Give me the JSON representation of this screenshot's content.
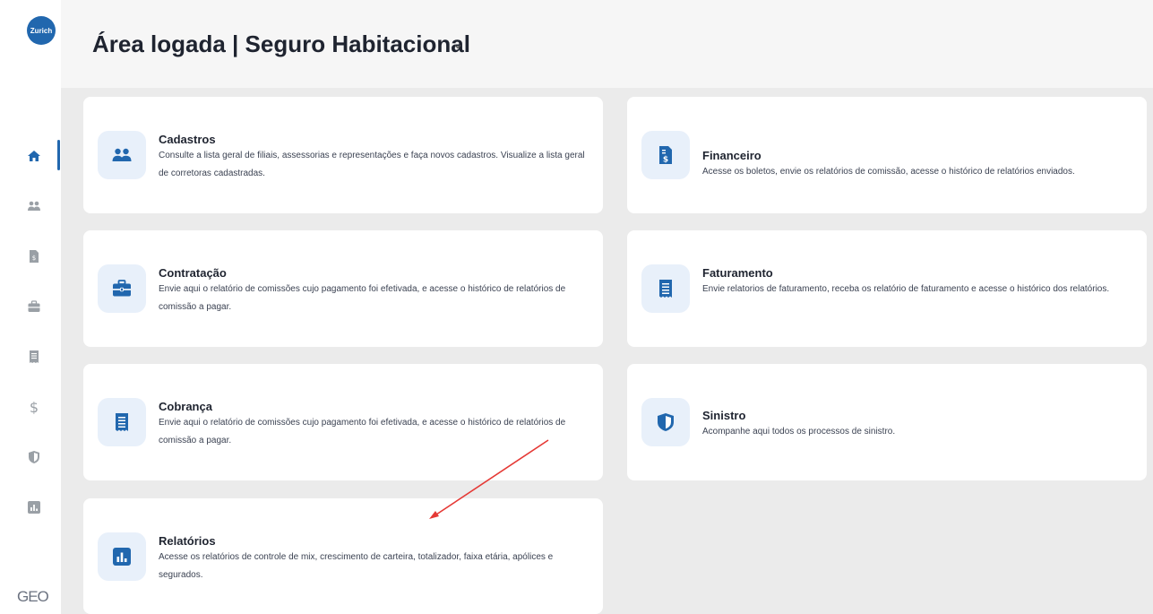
{
  "logo": {
    "text": "Zurich"
  },
  "header": {
    "title": "Área logada | Seguro Habitacional"
  },
  "footer": {
    "brand": "GEO"
  },
  "sidebar": {
    "items": [
      {
        "icon": "home-icon",
        "active": true
      },
      {
        "icon": "users-icon",
        "active": false
      },
      {
        "icon": "invoice-icon",
        "active": false
      },
      {
        "icon": "briefcase-icon",
        "active": false
      },
      {
        "icon": "receipt-icon",
        "active": false
      },
      {
        "icon": "dollar-icon",
        "active": false
      },
      {
        "icon": "shield-icon",
        "active": false
      },
      {
        "icon": "chart-icon",
        "active": false
      }
    ]
  },
  "cards": {
    "cadastros": {
      "title": "Cadastros",
      "desc": "Consulte a lista geral de filiais, assessorias e representações e faça novos cadastros. Visualize a lista geral de corretoras cadastradas.",
      "icon": "users-icon"
    },
    "financeiro": {
      "title": "Financeiro",
      "desc": "Acesse os boletos, envie os relatórios de comissão, acesse o histórico de relatórios enviados.",
      "icon": "invoice-icon"
    },
    "contratacao": {
      "title": "Contratação",
      "desc": "Envie aqui o relatório de comissões cujo pagamento foi efetivada, e acesse o histórico de relatórios de comissão a pagar.",
      "icon": "briefcase-icon"
    },
    "faturamento": {
      "title": "Faturamento",
      "desc": "Envie relatorios de faturamento, receba os relatório de faturamento e acesse o histórico dos relatórios.",
      "icon": "receipt-icon"
    },
    "cobranca": {
      "title": "Cobrança",
      "desc": "Envie aqui o relatório de comissões cujo pagamento foi efetivada, e acesse o histórico de relatórios de comissão a pagar.",
      "icon": "receipt-icon"
    },
    "sinistro": {
      "title": "Sinistro",
      "desc": "Acompanhe aqui todos os processos de sinistro.",
      "icon": "shield-icon"
    },
    "relatorios": {
      "title": "Relatórios",
      "desc": "Acesse os relatórios de controle de mix, crescimento de carteira, totalizador, faixa etária, apólices e segurados.",
      "icon": "chart-icon"
    }
  },
  "colors": {
    "accent": "#2167ae",
    "annotation": "#e53935",
    "icon_bg": "#e8f0fa"
  }
}
